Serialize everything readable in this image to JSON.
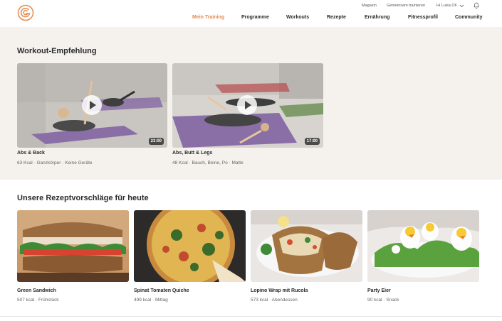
{
  "topnav": {
    "magazin": "Magazin",
    "gemeinsam": "Gemeinsam trainieren",
    "user": "Hi Luisa Oli"
  },
  "mainnav": [
    {
      "label": "Mein Training",
      "active": true
    },
    {
      "label": "Programme"
    },
    {
      "label": "Workouts"
    },
    {
      "label": "Rezepte"
    },
    {
      "label": "Ernährung"
    },
    {
      "label": "Fitnessprofil"
    },
    {
      "label": "Community"
    }
  ],
  "workouts": {
    "title": "Workout-Empfehlung",
    "items": [
      {
        "title": "Abs & Back",
        "meta": "63 Kcal · Ganzkörper · Keine Geräte",
        "duration": "23:00"
      },
      {
        "title": "Abs, Butt & Legs",
        "meta": "48 Kcal · Bauch, Beine, Po · Matte",
        "duration": "17:00"
      }
    ]
  },
  "recipes": {
    "title": "Unsere Rezeptvorschläge für heute",
    "items": [
      {
        "title": "Green Sandwich",
        "meta": "507 kcal · Frühstück"
      },
      {
        "title": "Spinat Tomaten Quiche",
        "meta": "499 kcal · Mittag"
      },
      {
        "title": "Lopino Wrap mit Rucola",
        "meta": "573 kcal · Abendessen"
      },
      {
        "title": "Party Eier",
        "meta": "90 kcal · Snack"
      }
    ]
  },
  "colors": {
    "accent": "#e58a52",
    "section_bg": "#f5f2ee",
    "mat": "#8a6fa6"
  }
}
